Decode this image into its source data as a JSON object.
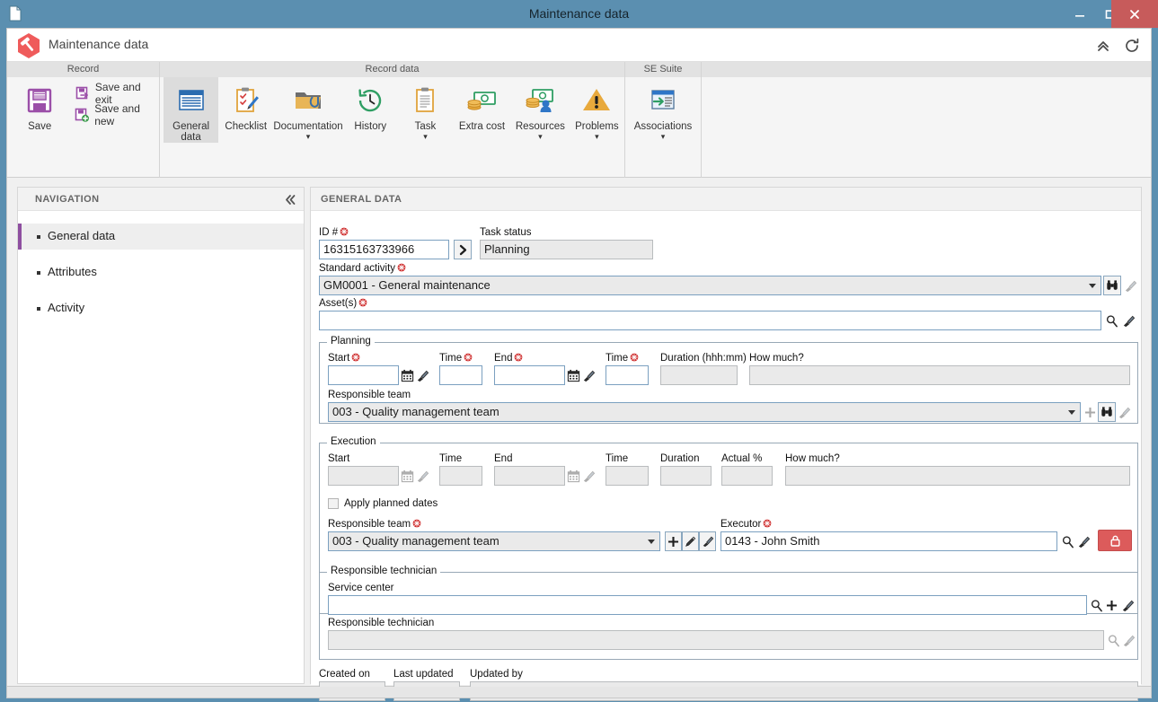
{
  "window": {
    "title": "Maintenance data",
    "doc_icon": "document-icon",
    "minimize_label": "—",
    "maximize_label": "❐",
    "close_label": "✕"
  },
  "app": {
    "title": "Maintenance data",
    "logo_icon": "hammer-hexagon-logo",
    "collapse_icon": "chevron-double-up-icon",
    "refresh_icon": "refresh-icon"
  },
  "ribbon": {
    "groups": [
      {
        "title": "Record",
        "buttons": [
          {
            "label": "Save",
            "icon": "floppy-disk-icon",
            "type": "big",
            "caret": false
          },
          {
            "label": "Save and exit",
            "icon": "save-exit-icon",
            "type": "small"
          },
          {
            "label": "Save and new",
            "icon": "save-new-icon",
            "type": "small"
          }
        ]
      },
      {
        "title": "Record data",
        "buttons": [
          {
            "label": "General data",
            "icon": "general-data-icon",
            "type": "big",
            "caret": false,
            "active": true
          },
          {
            "label": "Checklist",
            "icon": "checklist-icon",
            "type": "big",
            "caret": false
          },
          {
            "label": "Documentation",
            "icon": "documentation-folder-icon",
            "type": "big",
            "caret": true
          },
          {
            "label": "History",
            "icon": "history-clock-icon",
            "type": "big",
            "caret": false
          },
          {
            "label": "Task",
            "icon": "task-clipboard-icon",
            "type": "big",
            "caret": true
          },
          {
            "label": "Extra cost",
            "icon": "money-icon",
            "type": "big",
            "caret": false
          },
          {
            "label": "Resources",
            "icon": "resources-person-money-icon",
            "type": "big",
            "caret": true
          },
          {
            "label": "Problems",
            "icon": "warning-triangle-icon",
            "type": "big",
            "caret": true
          }
        ]
      },
      {
        "title": "SE Suite",
        "buttons": [
          {
            "label": "Associations",
            "icon": "associations-window-icon",
            "type": "big",
            "caret": true
          }
        ]
      }
    ]
  },
  "navigation": {
    "title": "NAVIGATION",
    "collapse_icon": "chevron-double-left-icon",
    "items": [
      {
        "label": "General data",
        "selected": true
      },
      {
        "label": "Attributes",
        "selected": false
      },
      {
        "label": "Activity",
        "selected": false
      }
    ]
  },
  "form": {
    "title": "GENERAL DATA",
    "id": {
      "label": "ID #",
      "required": true,
      "value": "16315163733966",
      "go_icon": "chevron-right-icon"
    },
    "task_status": {
      "label": "Task status",
      "required": false,
      "value": "Planning",
      "readonly": true
    },
    "standard_activity": {
      "label": "Standard activity",
      "required": true,
      "value": "GM0001 - General maintenance",
      "search_icon": "binoculars-icon",
      "clear_icon": "brush-clear-icon",
      "clear_disabled": true
    },
    "assets": {
      "label": "Asset(s)",
      "required": true,
      "value": "",
      "search_icon": "magnifier-icon",
      "clear_icon": "brush-clear-icon"
    },
    "planning": {
      "legend": "Planning",
      "start": {
        "label": "Start",
        "required": true,
        "value": "",
        "calendar_icon": "calendar-icon",
        "clear_icon": "brush-clear-icon"
      },
      "start_time": {
        "label": "Time",
        "required": true,
        "value": ""
      },
      "end": {
        "label": "End",
        "required": true,
        "value": "",
        "calendar_icon": "calendar-icon",
        "clear_icon": "brush-clear-icon"
      },
      "end_time": {
        "label": "Time",
        "required": true,
        "value": ""
      },
      "duration": {
        "label": "Duration (hhh:mm)",
        "required": false,
        "value": "",
        "readonly": true
      },
      "how_much": {
        "label": "How much?",
        "required": false,
        "value": "",
        "readonly": true
      },
      "responsible_team": {
        "label": "Responsible team",
        "required": false,
        "value": "003 - Quality management team",
        "add_icon": "plus-icon",
        "add_disabled": true,
        "search_icon": "binoculars-icon",
        "clear_icon": "brush-clear-icon",
        "clear_disabled": true
      }
    },
    "execution": {
      "legend": "Execution",
      "start": {
        "label": "Start",
        "required": false,
        "value": "",
        "readonly": true,
        "calendar_icon": "calendar-icon",
        "clear_icon": "brush-clear-icon"
      },
      "start_time": {
        "label": "Time",
        "required": false,
        "value": "",
        "readonly": true
      },
      "end": {
        "label": "End",
        "required": false,
        "value": "",
        "readonly": true,
        "calendar_icon": "calendar-icon",
        "clear_icon": "brush-clear-icon"
      },
      "end_time": {
        "label": "Time",
        "required": false,
        "value": "",
        "readonly": true
      },
      "duration": {
        "label": "Duration",
        "required": false,
        "value": "",
        "readonly": true
      },
      "actual_pct": {
        "label": "Actual %",
        "required": false,
        "value": "",
        "readonly": true
      },
      "how_much": {
        "label": "How much?",
        "required": false,
        "value": "",
        "readonly": true
      },
      "apply_planned_dates": {
        "label": "Apply planned dates",
        "checked": false
      },
      "responsible_team": {
        "label": "Responsible team",
        "required": true,
        "value": "003 - Quality management team",
        "add_icon": "plus-icon",
        "edit_icon": "pencil-icon",
        "clear_icon": "brush-clear-icon"
      },
      "executor": {
        "label": "Executor",
        "required": true,
        "value": "0143 - John Smith",
        "search_icon": "magnifier-icon",
        "clear_icon": "brush-clear-icon",
        "lock_icon": "padlock-icon"
      }
    },
    "responsible_technician_group": {
      "legend": "Responsible technician",
      "service_center": {
        "label": "Service center",
        "required": false,
        "value": "",
        "search_icon": "magnifier-icon",
        "add_icon": "plus-icon",
        "clear_icon": "brush-clear-icon"
      },
      "responsible_technician": {
        "label": "Responsible technician",
        "required": false,
        "value": "",
        "readonly": true,
        "search_icon": "magnifier-icon",
        "clear_icon": "brush-clear-icon"
      }
    },
    "footer": {
      "created_on": {
        "label": "Created on",
        "value": "",
        "readonly": true
      },
      "last_updated": {
        "label": "Last updated",
        "value": "",
        "readonly": true
      },
      "updated_by": {
        "label": "Updated by",
        "value": "",
        "readonly": true
      }
    }
  },
  "colors": {
    "titlebar": "#5b8fb0",
    "close_button": "#c75b5b",
    "accent_purple": "#8e4fa0",
    "required_marker": "#cc2222",
    "lock_button": "#dc5b5b"
  }
}
